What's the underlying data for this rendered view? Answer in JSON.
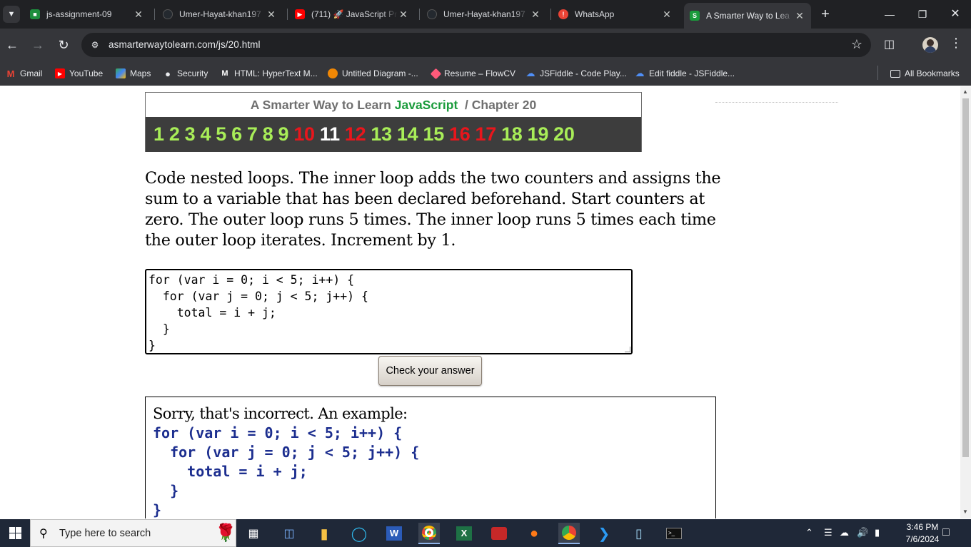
{
  "tabs": [
    {
      "title": "js-assignment-09",
      "icon": "google-classroom-icon",
      "color": "#1e8e3e"
    },
    {
      "title": "Umer-Hayat-khan197",
      "icon": "github-icon",
      "color": "#24292f"
    },
    {
      "title": "(711) 🚀 JavaScript Pr",
      "icon": "youtube-icon",
      "color": "#ff0000"
    },
    {
      "title": "Umer-Hayat-khan197",
      "icon": "github-icon",
      "color": "#24292f"
    },
    {
      "title": "WhatsApp",
      "icon": "whatsapp-alert-icon",
      "color": "#ea4335"
    },
    {
      "title": "A Smarter Way to Lea",
      "icon": "smarter-way-icon",
      "color": "#1a9b3b",
      "active": true
    }
  ],
  "address": {
    "url": "asmarterwaytolearn.com/js/20.html"
  },
  "bookmarks": [
    {
      "label": "Gmail",
      "icon": "gmail-icon",
      "color": "#ea4335"
    },
    {
      "label": "YouTube",
      "icon": "youtube-icon",
      "color": "#ff0000"
    },
    {
      "label": "Maps",
      "icon": "maps-icon",
      "color": "#34a853"
    },
    {
      "label": "Security",
      "icon": "globe-icon",
      "color": "#9aa0a6"
    },
    {
      "label": "HTML: HyperText M...",
      "icon": "mdn-icon",
      "color": "#ffffff"
    },
    {
      "label": "Untitled Diagram -...",
      "icon": "drawio-icon",
      "color": "#f08705"
    },
    {
      "label": "Resume – FlowCV",
      "icon": "flowcv-icon",
      "color": "#ff5a7a"
    },
    {
      "label": "JSFiddle - Code Play...",
      "icon": "jsfiddle-icon",
      "color": "#4f8ff7"
    },
    {
      "label": "Edit fiddle - JSFiddle...",
      "icon": "jsfiddle-icon",
      "color": "#4f8ff7"
    }
  ],
  "all_bookmarks": "All Bookmarks",
  "page": {
    "title_prefix": "A Smarter Way to Learn",
    "title_js": "JavaScript",
    "title_suffix": "/  Chapter 20",
    "chapters": [
      {
        "n": "1",
        "state": "ok"
      },
      {
        "n": "2",
        "state": "ok"
      },
      {
        "n": "3",
        "state": "ok"
      },
      {
        "n": "4",
        "state": "ok"
      },
      {
        "n": "5",
        "state": "ok"
      },
      {
        "n": "6",
        "state": "ok"
      },
      {
        "n": "7",
        "state": "ok"
      },
      {
        "n": "8",
        "state": "ok"
      },
      {
        "n": "9",
        "state": "ok"
      },
      {
        "n": "10",
        "state": "bad"
      },
      {
        "n": "11",
        "state": "cur"
      },
      {
        "n": "12",
        "state": "bad"
      },
      {
        "n": "13",
        "state": "ok"
      },
      {
        "n": "14",
        "state": "ok"
      },
      {
        "n": "15",
        "state": "ok"
      },
      {
        "n": "16",
        "state": "bad"
      },
      {
        "n": "17",
        "state": "bad"
      },
      {
        "n": "18",
        "state": "ok"
      },
      {
        "n": "19",
        "state": "ok"
      },
      {
        "n": "20",
        "state": "ok"
      }
    ],
    "instructions": "Code nested loops. The inner loop adds the two counters and assigns the sum to a variable that has been declared beforehand. Start counters at zero. The outer loop runs 5 times. The inner loop runs 5 times each time the outer loop iterates. Increment by 1.",
    "answer_code": "for (var i = 0; i < 5; i++) {\n  for (var j = 0; j < 5; j++) {\n    total = i + j;\n  }\n}",
    "check_button": "Check your answer",
    "result_message": "Sorry, that's incorrect. An example:",
    "example_code": "for (var i = 0; i < 5; i++) {\n  for (var j = 0; j < 5; j++) {\n    total = i + j;\n  }\n}"
  },
  "colors": {
    "ok": "#a8ed58",
    "bad": "#e8161c",
    "cur": "#ffffff",
    "js_green": "#1a9b3b",
    "example_code": "#1c2e8f"
  },
  "taskbar": {
    "search_placeholder": "Type here to search",
    "apps": [
      "task-view-icon",
      "this-pc-icon",
      "file-explorer-icon",
      "edge-icon",
      "word-icon",
      "chrome-icon",
      "excel-icon",
      "screen-recorder-icon",
      "firefox-icon",
      "chrome-profile-icon",
      "vscode-icon",
      "notepad-icon",
      "terminal-icon"
    ],
    "time": "3:46 PM",
    "date": "7/6/2024"
  }
}
